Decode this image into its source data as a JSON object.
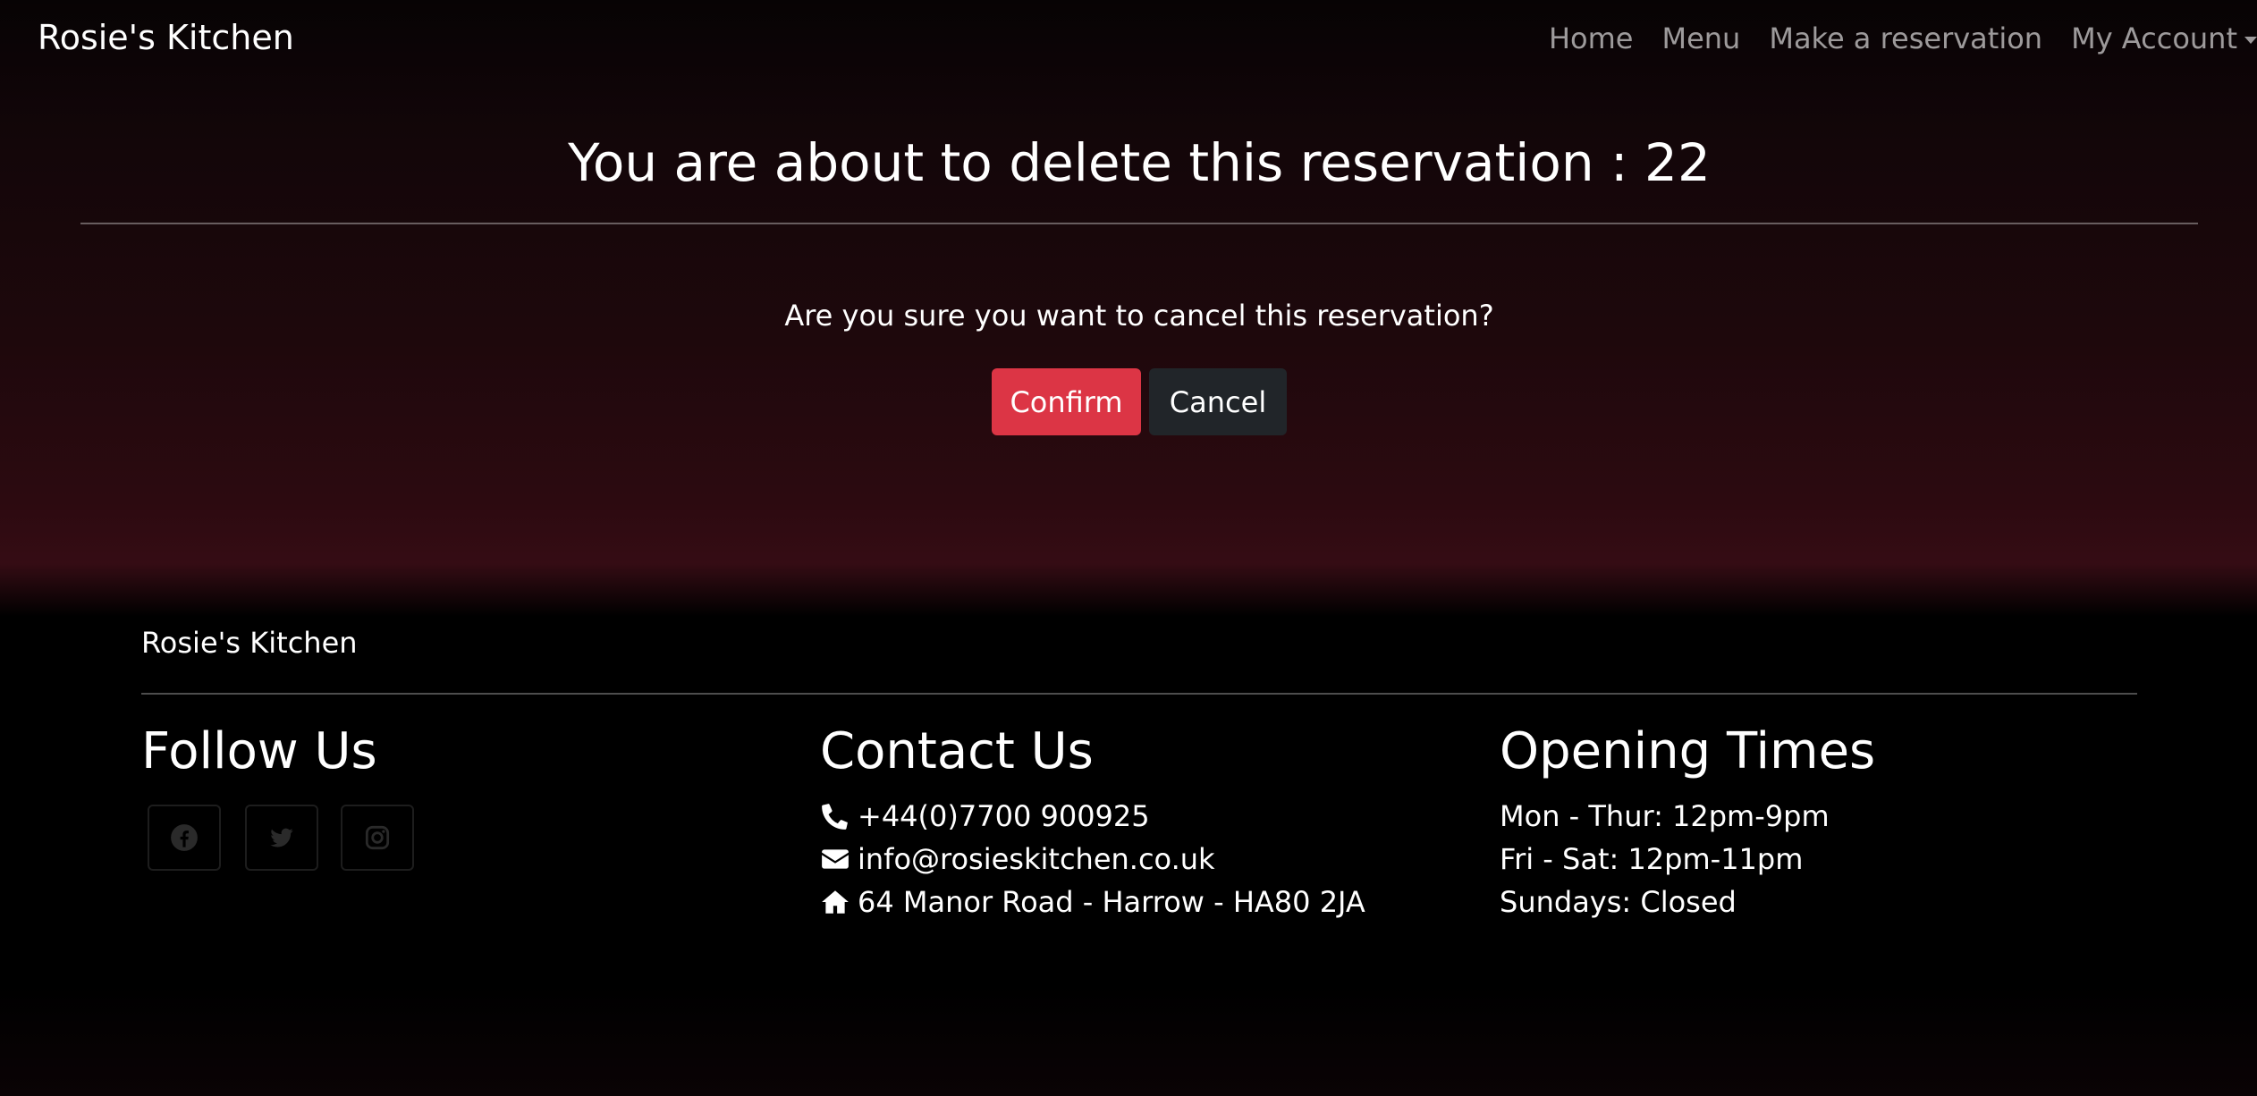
{
  "navbar": {
    "brand": "Rosie's Kitchen",
    "links": [
      "Home",
      "Menu",
      "Make a reservation",
      "My Account"
    ]
  },
  "dialog": {
    "title": "You are about to delete this reservation : 22",
    "question": "Are you sure you want to cancel this reservation?",
    "confirm_label": "Confirm",
    "cancel_label": "Cancel"
  },
  "footer": {
    "brand": "Rosie's Kitchen",
    "follow": {
      "heading": "Follow Us",
      "icons": [
        "facebook-icon",
        "twitter-icon",
        "instagram-icon"
      ]
    },
    "contact": {
      "heading": "Contact Us",
      "phone": "+44(0)7700 900925",
      "email": "info@rosieskitchen.co.uk",
      "address": "64 Manor Road - Harrow - HA80 2JA"
    },
    "hours": {
      "heading": "Opening Times",
      "lines": [
        "Mon - Thur: 12pm-9pm",
        "Fri - Sat: 12pm-11pm",
        "Sundays: Closed"
      ]
    }
  },
  "colors": {
    "confirm": "#dc3545",
    "cancel": "#212529",
    "background_top": "#070304",
    "background_glow": "#350c14"
  }
}
